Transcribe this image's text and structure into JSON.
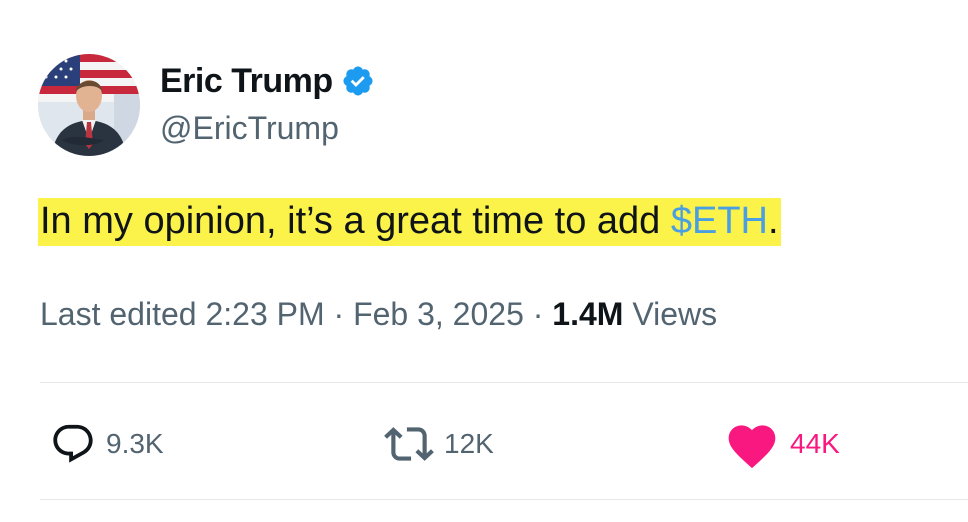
{
  "author": {
    "display_name": "Eric Trump",
    "handle": "@EricTrump",
    "verified": true,
    "verified_icon": "verified-badge-icon",
    "verified_color": "#1d9bf0"
  },
  "tweet": {
    "text_before": "In my opinion, it’s a great time to add ",
    "cashtag": "$ETH",
    "text_after": ".",
    "highlight_color": "#fbf24a",
    "cashtag_color": "#4a9fe3"
  },
  "meta": {
    "edited_prefix": "Last edited",
    "time": "2:23 PM",
    "separator": "·",
    "date": "Feb 3, 2025",
    "views_count": "1.4M",
    "views_label": "Views"
  },
  "actions": {
    "replies": {
      "icon": "reply-icon",
      "count": "9.3K"
    },
    "reposts": {
      "icon": "repost-icon",
      "count": "12K"
    },
    "likes": {
      "icon": "heart-icon",
      "count": "44K",
      "color": "#f91880",
      "liked": true
    }
  }
}
